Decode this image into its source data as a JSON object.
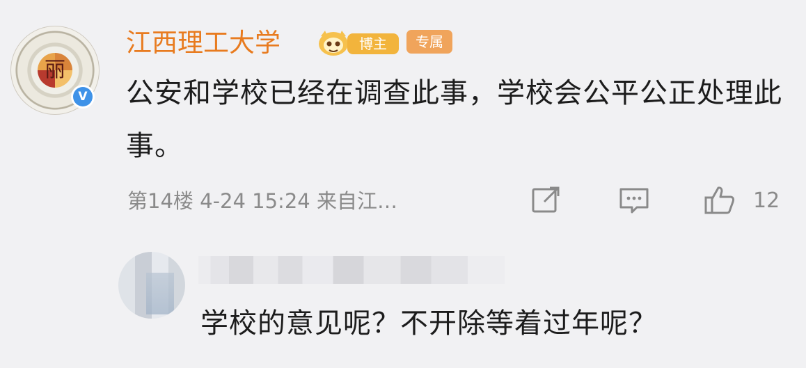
{
  "post": {
    "username": "江西理工大学",
    "badges": {
      "host_label": "博主",
      "exclusive_label": "专属"
    },
    "avatar_mark": "丽",
    "content": "公安和学校已经在调查此事，学校会公平公正处理此事。",
    "meta": "第14楼  4-24 15:24  来自江…",
    "actions": {
      "share_icon": "share-icon",
      "comment_icon": "comment-icon",
      "like_icon": "thumbs-up-icon",
      "like_count": "12"
    },
    "colors": {
      "username": "#e87b1f",
      "host_badge": "#f2b43c",
      "exclusive_badge": "#f0a45b",
      "verified": "#3e92e8"
    }
  },
  "reply": {
    "text": "学校的意见呢？不开除等着过年呢？"
  }
}
